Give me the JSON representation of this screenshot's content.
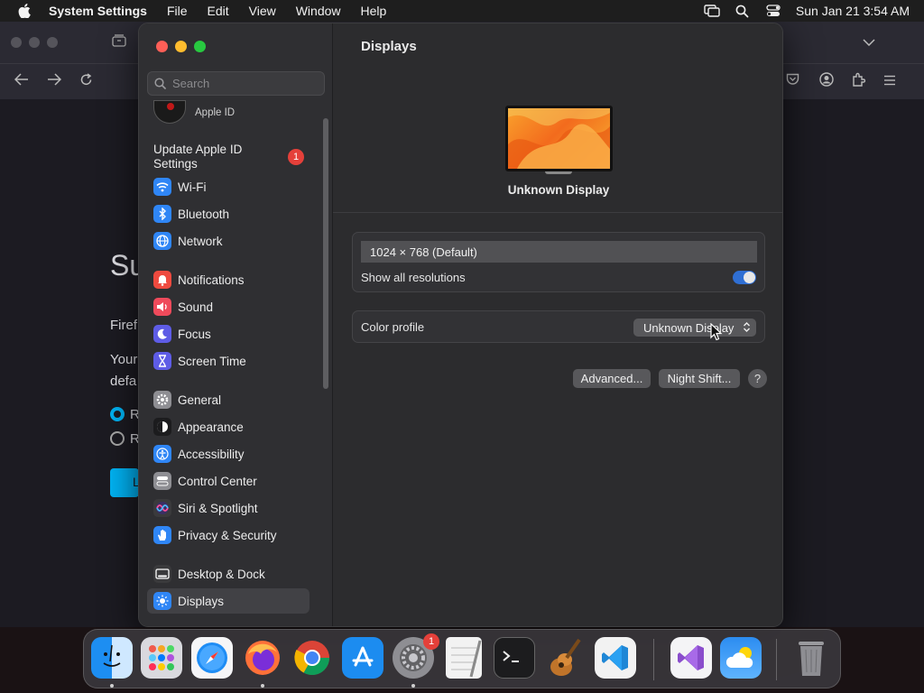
{
  "menubar": {
    "app_name": "System Settings",
    "items": [
      "File",
      "Edit",
      "View",
      "Window",
      "Help"
    ],
    "clock": "Sun Jan 21  3:54 AM"
  },
  "background_window": {
    "heading_fragment": "Su",
    "line1": "Firef",
    "line2": "Your",
    "line3": "defa",
    "radio1": "R",
    "radio2": "R",
    "button_fragment": "L"
  },
  "sidebar": {
    "search_placeholder": "Search",
    "apple_id_label": "Apple ID",
    "update_label": "Update Apple ID Settings",
    "update_badge": "1",
    "items": [
      {
        "label": "Wi-Fi",
        "icon": "wifi-icon",
        "color": "#2f86f6"
      },
      {
        "label": "Bluetooth",
        "icon": "bluetooth-icon",
        "color": "#2f86f6"
      },
      {
        "label": "Network",
        "icon": "globe-icon",
        "color": "#2f86f6"
      },
      {
        "label": "Notifications",
        "icon": "bell-icon",
        "color": "#ef4a3f"
      },
      {
        "label": "Sound",
        "icon": "speaker-icon",
        "color": "#ef4a5b"
      },
      {
        "label": "Focus",
        "icon": "moon-icon",
        "color": "#5e5ce6"
      },
      {
        "label": "Screen Time",
        "icon": "hourglass-icon",
        "color": "#5e5ce6"
      },
      {
        "label": "General",
        "icon": "gear-icon",
        "color": "#8e8e93"
      },
      {
        "label": "Appearance",
        "icon": "appearance-icon",
        "color": "#1c1c1e"
      },
      {
        "label": "Accessibility",
        "icon": "accessibility-icon",
        "color": "#2f86f6"
      },
      {
        "label": "Control Center",
        "icon": "control-center-icon",
        "color": "#8e8e93"
      },
      {
        "label": "Siri & Spotlight",
        "icon": "siri-icon",
        "color": "#3a3a3c"
      },
      {
        "label": "Privacy & Security",
        "icon": "hand-icon",
        "color": "#2f86f6"
      },
      {
        "label": "Desktop & Dock",
        "icon": "dock-icon",
        "color": "#3a3a3c"
      },
      {
        "label": "Displays",
        "icon": "sun-icon",
        "color": "#2f86f6"
      }
    ],
    "selected": "Displays"
  },
  "main": {
    "title": "Displays",
    "display_name": "Unknown Display",
    "resolution": "1024 × 768 (Default)",
    "show_all_label": "Show all resolutions",
    "show_all_on": true,
    "color_profile_label": "Color profile",
    "color_profile_value": "Unknown Display",
    "advanced_label": "Advanced...",
    "night_shift_label": "Night Shift...",
    "help_label": "?"
  },
  "dock": {
    "settings_badge": "1",
    "apps": [
      "Finder",
      "Launchpad",
      "Safari",
      "Firefox",
      "Chrome",
      "App Store",
      "System Settings",
      "TextEdit",
      "Terminal",
      "GarageBand",
      "Visual Studio Code",
      "Visual Studio",
      "Weather",
      "Trash"
    ]
  }
}
